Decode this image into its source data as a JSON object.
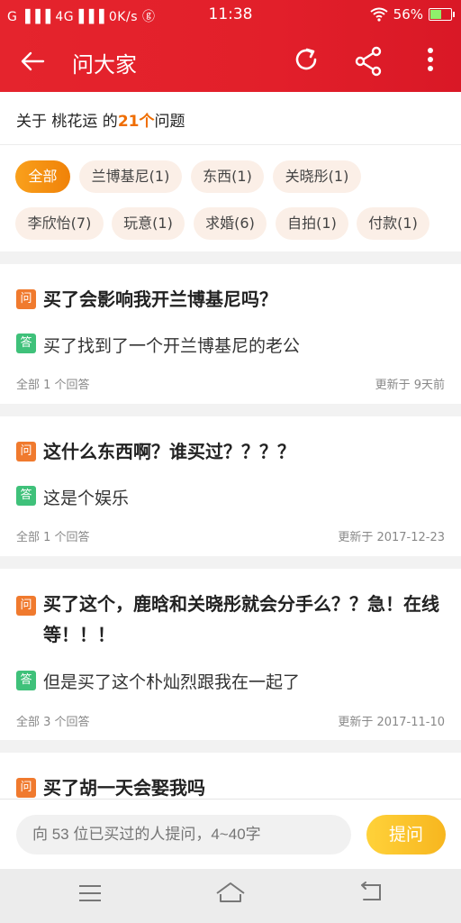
{
  "status_bar": {
    "signal_text": "G ▐▐▐ 4G▐▐▐ 0K/s ⓖ",
    "time": "11:38",
    "battery": "56%"
  },
  "header": {
    "title": "问大家"
  },
  "summary": {
    "prefix": "关于 桃花运 的",
    "count": "21个",
    "suffix": "问题"
  },
  "tags": [
    {
      "label": "全部"
    },
    {
      "label": "兰博基尼(1)"
    },
    {
      "label": "东西(1)"
    },
    {
      "label": "关晓彤(1)"
    },
    {
      "label": "李欣怡(7)"
    },
    {
      "label": "玩意(1)"
    },
    {
      "label": "求婚(6)"
    },
    {
      "label": "自拍(1)"
    },
    {
      "label": "付款(1)"
    }
  ],
  "badges": {
    "question": "问",
    "answer": "答"
  },
  "questions": [
    {
      "question": "买了会影响我开兰博基尼吗？",
      "answer": "买了找到了一个开兰博基尼的老公",
      "answers_count": "全部 1 个回答",
      "updated": "更新于 9天前"
    },
    {
      "question": "这什么东西啊？谁买过？？？？",
      "answer": "这是个娱乐",
      "answers_count": "全部 1 个回答",
      "updated": "更新于 2017-12-23"
    },
    {
      "question": "买了这个，鹿晗和关晓彤就会分手么？？急！在线等！！！",
      "answer": "但是买了这个朴灿烈跟我在一起了",
      "answers_count": "全部 3 个回答",
      "updated": "更新于 2017-11-10"
    },
    {
      "question": "买了胡一天会娶我吗"
    }
  ],
  "ask_bar": {
    "placeholder": "向 53 位已买过的人提问，4~40字",
    "button_label": "提问"
  },
  "colors": {
    "header_red": "#e21f2a",
    "accent_orange": "#f08208",
    "question_badge": "#f07a2e",
    "answer_badge": "#3fc17a",
    "ask_button": "#f7b61f"
  }
}
